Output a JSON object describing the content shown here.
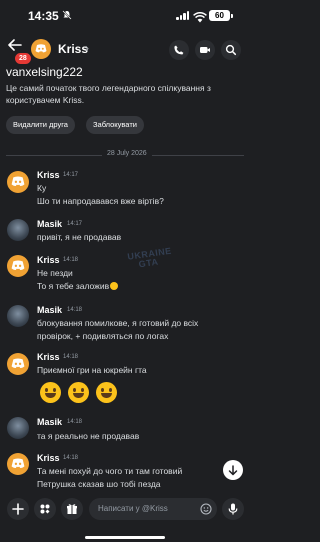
{
  "status": {
    "time": "14:35",
    "battery": "60"
  },
  "header": {
    "unread_badge": "28",
    "title": "Kriss"
  },
  "profile": {
    "username": "vanxelsing222",
    "intro_line1": "Це самий початок твого легендарного спілкування з",
    "intro_line2": "користувачем Kriss.",
    "actions": [
      "Видалити друга",
      "Заблокувати"
    ]
  },
  "date_divider": "28 July 2026",
  "messages": [
    {
      "author": "Kriss",
      "time": "14:17",
      "lines": [
        "Ку",
        "Шо ти напродавався вже віртів?"
      ]
    },
    {
      "author": "Masik",
      "time": "14:17",
      "lines": [
        "привіт, я не продавав"
      ]
    },
    {
      "author": "Kriss",
      "time": "14:18",
      "lines": [
        "Не пезди",
        "То я тебе заложив"
      ]
    },
    {
      "author": "Masik",
      "time": "14:18",
      "lines": [
        "блокування помилкове, я готовий до всіх",
        "провірок, + подивляться по логах"
      ]
    },
    {
      "author": "Kriss",
      "time": "14:18",
      "lines": [
        "Приємної гри на юкрейн гта"
      ]
    },
    {
      "author": "Masik",
      "time": "14:18",
      "lines": [
        "та я реально не продавав"
      ]
    },
    {
      "author": "Kriss",
      "time": "14:18",
      "lines": [
        "Та мені похуй до чого ти там готовий",
        "Петрушка сказав шо тобі пезда"
      ]
    }
  ],
  "composer": {
    "placeholder": "Написати у @Kriss"
  },
  "watermark": {
    "line1": "UKRAINE",
    "line2": "GTA"
  }
}
